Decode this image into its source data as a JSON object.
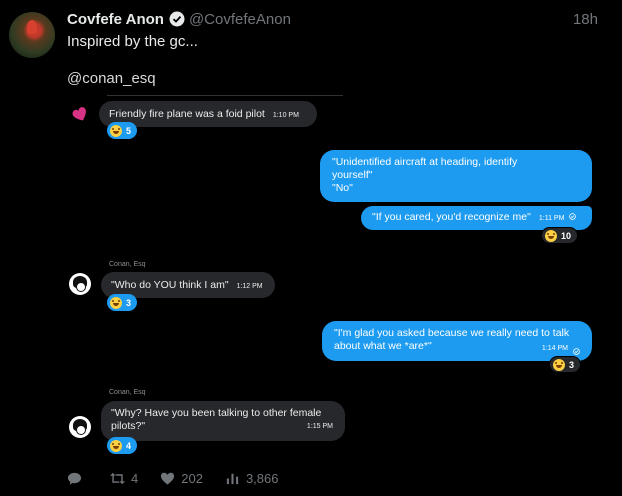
{
  "tweet": {
    "author_name": "Covfefe Anon",
    "handle": "@CovfefeAnon",
    "time": "18h",
    "text": "Inspired by the gc...",
    "mention": "@conan_esq"
  },
  "chat": {
    "messages": [
      {
        "side": "in",
        "sender": "",
        "text": "Friendly fire plane was a foid pilot",
        "time": "1:10 PM",
        "reaction_count": "5"
      },
      {
        "side": "out",
        "text_lines": [
          "\"Unidentified aircraft at heading, identify",
          "yourself\"",
          "\"No\""
        ]
      },
      {
        "side": "out",
        "text": "\"If you cared, you'd recognize me\"",
        "time": "1:11 PM",
        "reaction_count": "10"
      },
      {
        "side": "in",
        "sender": "Conan, Esq",
        "text": "\"Who do YOU think I am\"",
        "time": "1:12 PM",
        "reaction_count": "3"
      },
      {
        "side": "out",
        "text_lines": [
          "\"I'm glad you asked because we really need to talk",
          "about what we *are*\""
        ],
        "time": "1:14 PM",
        "reaction_count": "3"
      },
      {
        "side": "in",
        "sender": "Conan, Esq",
        "text_lines": [
          "\"Why? Have you been talking to other female",
          "pilots?\""
        ],
        "time": "1:15 PM",
        "reaction_count": "4"
      }
    ]
  },
  "actions": {
    "retweets": "4",
    "likes": "202",
    "views": "3,866"
  },
  "colors": {
    "accent": "#1d9bf0",
    "incoming_bubble": "#26282c",
    "muted_text": "#71767b"
  },
  "icons": [
    "verified-icon",
    "reply-icon",
    "retweet-icon",
    "like-icon",
    "views-icon",
    "laugh-emoji-icon",
    "check-circle-icon"
  ]
}
